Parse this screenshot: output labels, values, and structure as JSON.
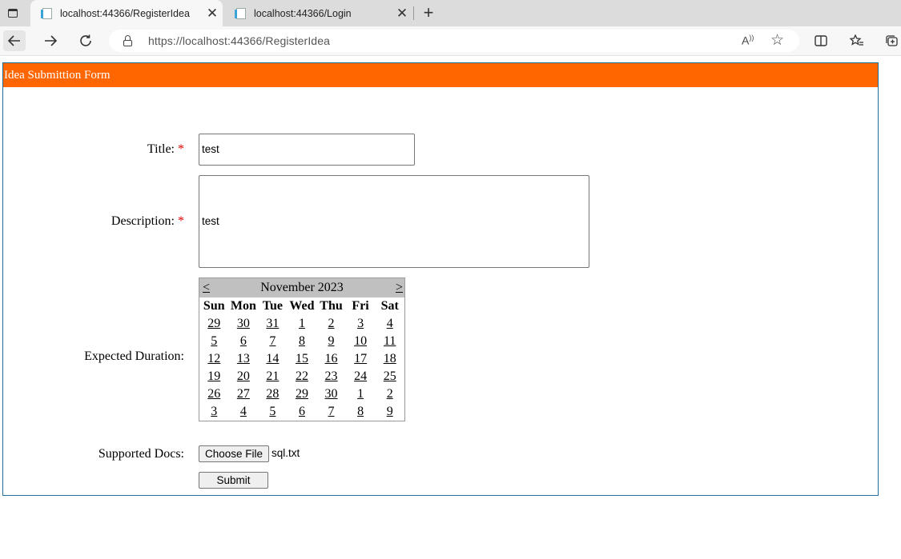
{
  "browser": {
    "tabs": [
      {
        "label": "localhost:44366/RegisterIdea",
        "active": true
      },
      {
        "label": "localhost:44366/Login",
        "active": false
      }
    ],
    "url": "https://localhost:44366/RegisterIdea",
    "tab_close_glyph": "✕",
    "new_tab_glyph": "+"
  },
  "form": {
    "header": "Idea Submittion Form",
    "title_label": "Title:",
    "title_value": "test",
    "description_label": "Description:",
    "description_value": "test",
    "required_marker": "*",
    "duration_label": "Expected Duration:",
    "docs_label": "Supported Docs:",
    "choose_file_label": "Choose File",
    "file_name": "sql.txt",
    "submit_label": "Submit"
  },
  "calendar": {
    "prev": "<",
    "next": ">",
    "month_title": "November 2023",
    "weekdays": [
      "Sun",
      "Mon",
      "Tue",
      "Wed",
      "Thu",
      "Fri",
      "Sat"
    ],
    "weeks": [
      [
        "29",
        "30",
        "31",
        "1",
        "2",
        "3",
        "4"
      ],
      [
        "5",
        "6",
        "7",
        "8",
        "9",
        "10",
        "11"
      ],
      [
        "12",
        "13",
        "14",
        "15",
        "16",
        "17",
        "18"
      ],
      [
        "19",
        "20",
        "21",
        "22",
        "23",
        "24",
        "25"
      ],
      [
        "26",
        "27",
        "28",
        "29",
        "30",
        "1",
        "2"
      ],
      [
        "3",
        "4",
        "5",
        "6",
        "7",
        "8",
        "9"
      ]
    ]
  },
  "colors": {
    "header_bg": "#ff6600",
    "panel_border": "#1f6f9a",
    "calendar_header_bg": "#c0c0c0",
    "required": "#e00000"
  }
}
